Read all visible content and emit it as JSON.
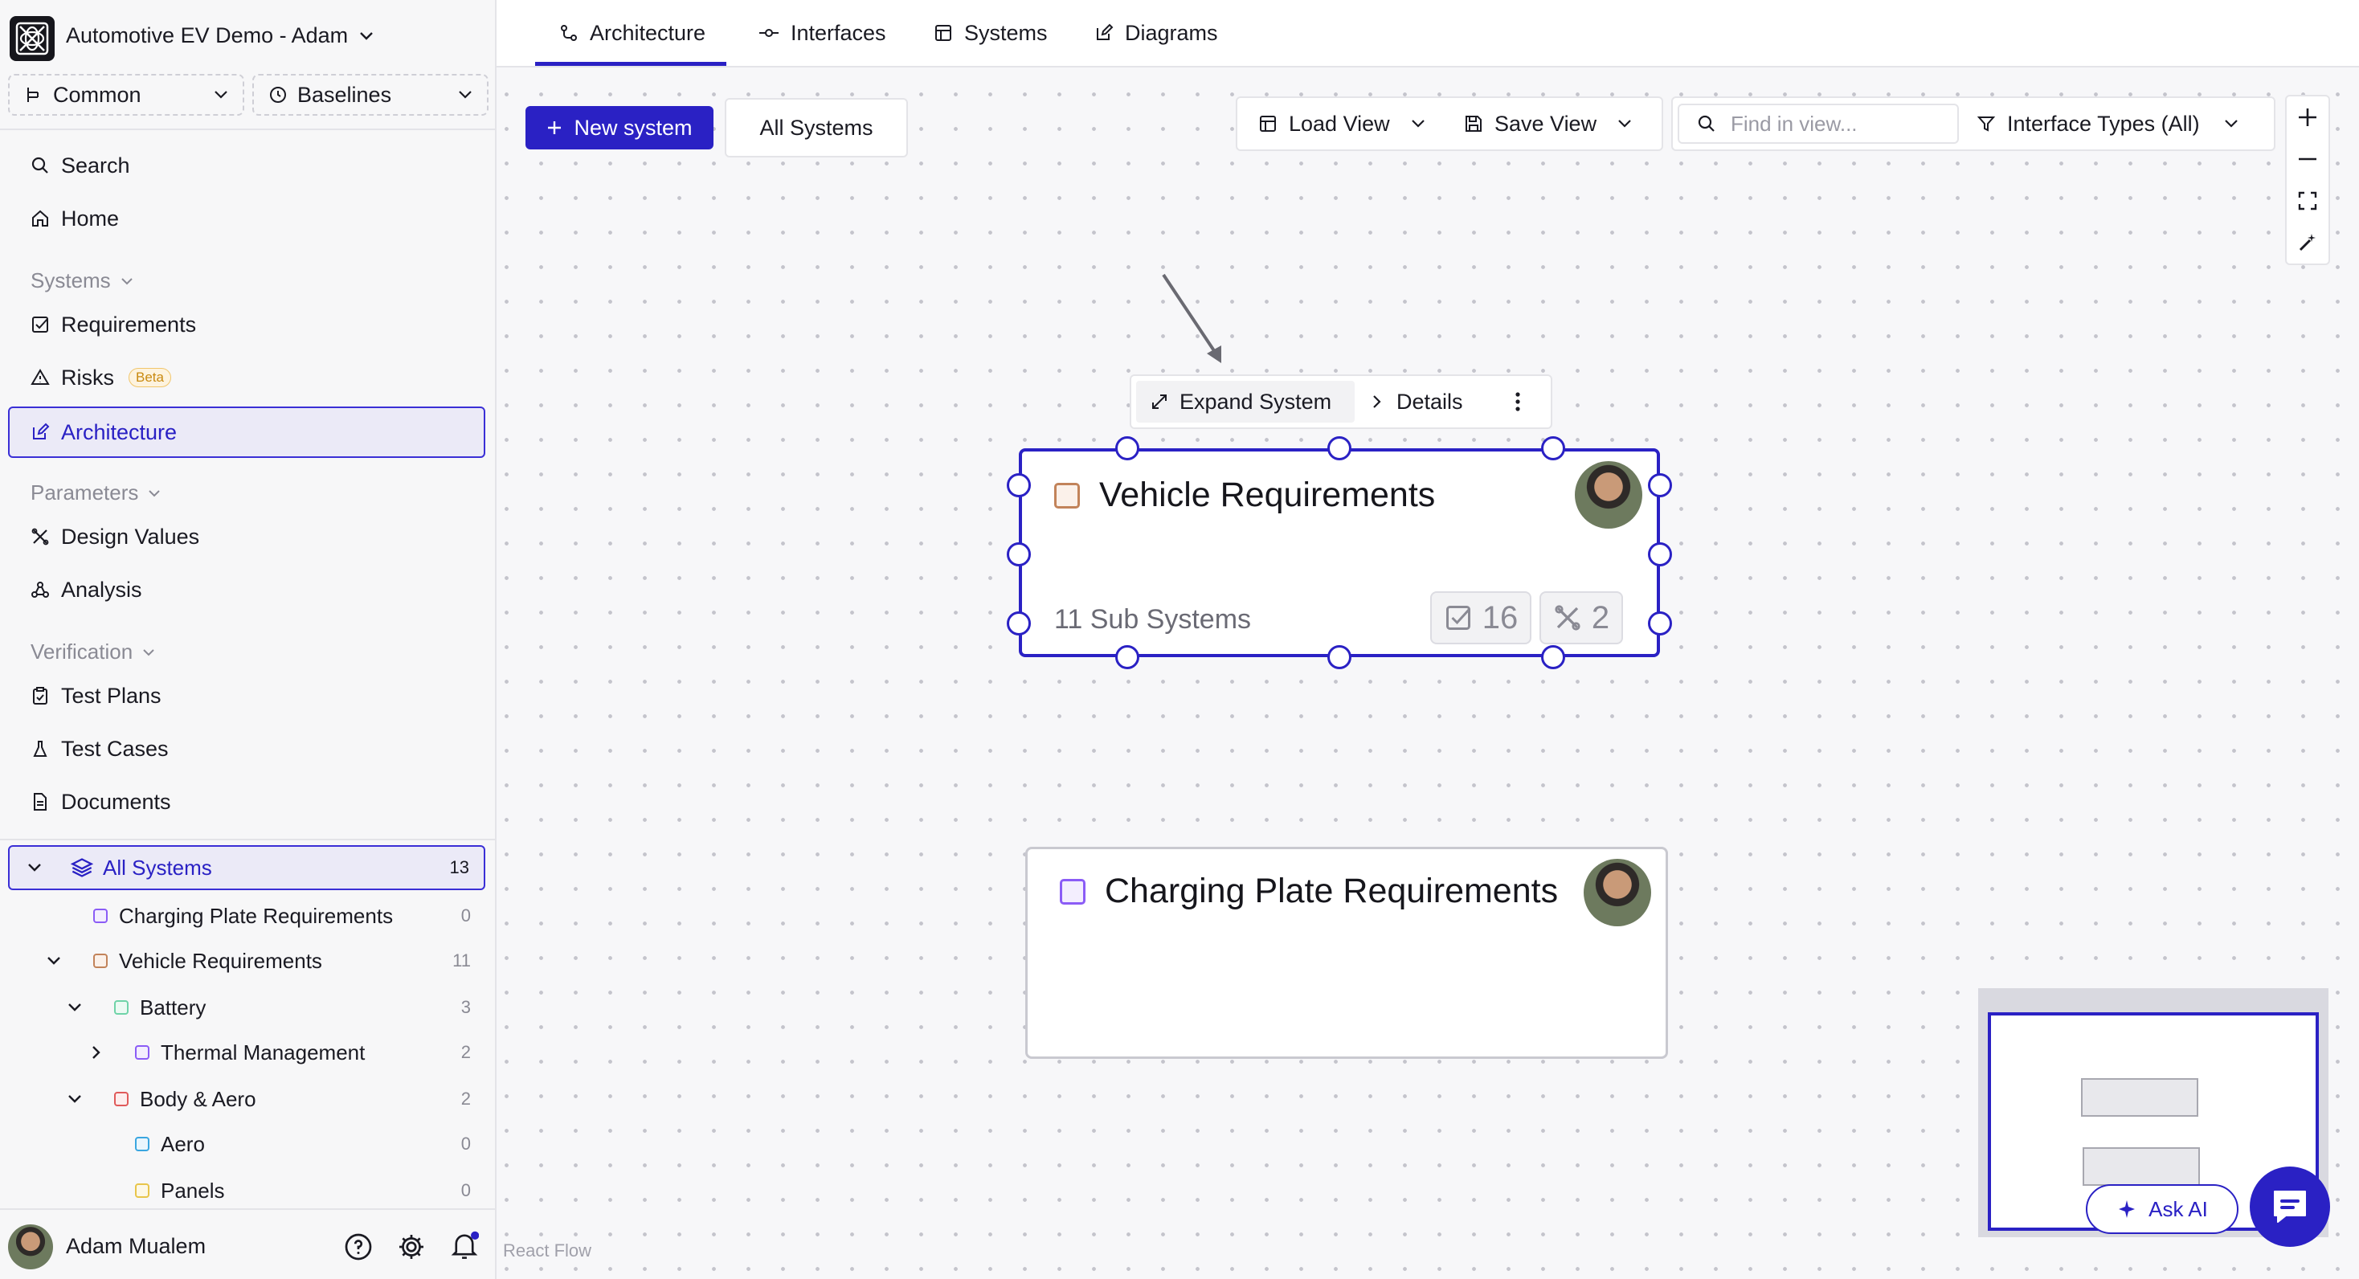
{
  "workspace": {
    "title": "Automotive EV Demo - Adam"
  },
  "selectors": {
    "branch": "Common",
    "baselines": "Baselines"
  },
  "nav": {
    "search": "Search",
    "home": "Home",
    "systems_section": "Systems",
    "requirements": "Requirements",
    "risks": "Risks",
    "risks_badge": "Beta",
    "architecture": "Architecture",
    "parameters_section": "Parameters",
    "design_values": "Design Values",
    "analysis": "Analysis",
    "verification_section": "Verification",
    "test_plans": "Test Plans",
    "test_cases": "Test Cases",
    "documents": "Documents"
  },
  "tree": {
    "root": {
      "label": "All Systems",
      "count": "13"
    },
    "items": [
      {
        "label": "Charging Plate Requirements",
        "count": "0",
        "color": "#8b5cf6"
      },
      {
        "label": "Vehicle Requirements",
        "count": "11",
        "color": "#c2835a"
      },
      {
        "label": "Battery",
        "count": "3",
        "color": "#6fd3a8"
      },
      {
        "label": "Thermal Management",
        "count": "2",
        "color": "#8b5cf6"
      },
      {
        "label": "Body & Aero",
        "count": "2",
        "color": "#e05a5a"
      },
      {
        "label": "Aero",
        "count": "0",
        "color": "#3aa6e0"
      },
      {
        "label": "Panels",
        "count": "0",
        "color": "#e8c54a"
      }
    ]
  },
  "user": {
    "name": "Adam Mualem"
  },
  "tabs": [
    "Architecture",
    "Interfaces",
    "Systems",
    "Diagrams"
  ],
  "canvas_toolbar": {
    "new_system": "New system",
    "all_systems": "All Systems",
    "load_view": "Load View",
    "save_view": "Save View",
    "find_placeholder": "Find in view...",
    "interface_types": "Interface Types (All)"
  },
  "node_toolbar": {
    "expand": "Expand System",
    "details": "Details"
  },
  "nodes": {
    "vehicle": {
      "title": "Vehicle Requirements",
      "subsystems": "11 Sub Systems",
      "requirements_count": "16",
      "design_values_count": "2"
    },
    "charging": {
      "title": "Charging Plate Requirements"
    }
  },
  "ask_ai": "Ask AI",
  "attribution": "React Flow",
  "colors": {
    "accent": "#2a21c4"
  }
}
